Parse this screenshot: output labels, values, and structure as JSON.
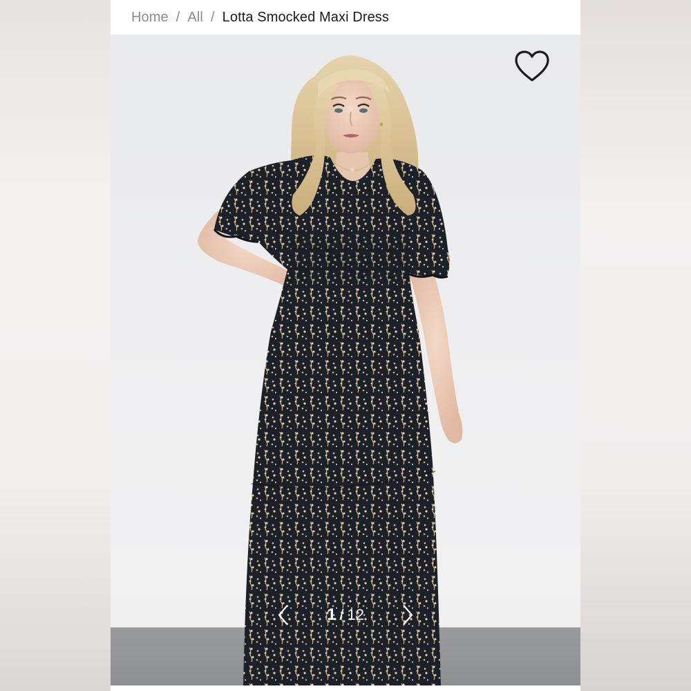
{
  "breadcrumb": {
    "items": [
      {
        "label": "Home"
      },
      {
        "label": "All"
      }
    ],
    "separator": "/",
    "current": "Lotta Smocked Maxi Dress"
  },
  "gallery": {
    "current_index": "1",
    "separator": "/",
    "total": "12",
    "prev_icon": "chevron-left-icon",
    "next_icon": "chevron-right-icon",
    "wishlist_icon": "heart-outline-icon"
  },
  "colors": {
    "breadcrumb_muted": "#8c8c8c",
    "breadcrumb_current": "#1a1a1a",
    "dress": "#1c2029",
    "print": "#d9c9a6"
  }
}
